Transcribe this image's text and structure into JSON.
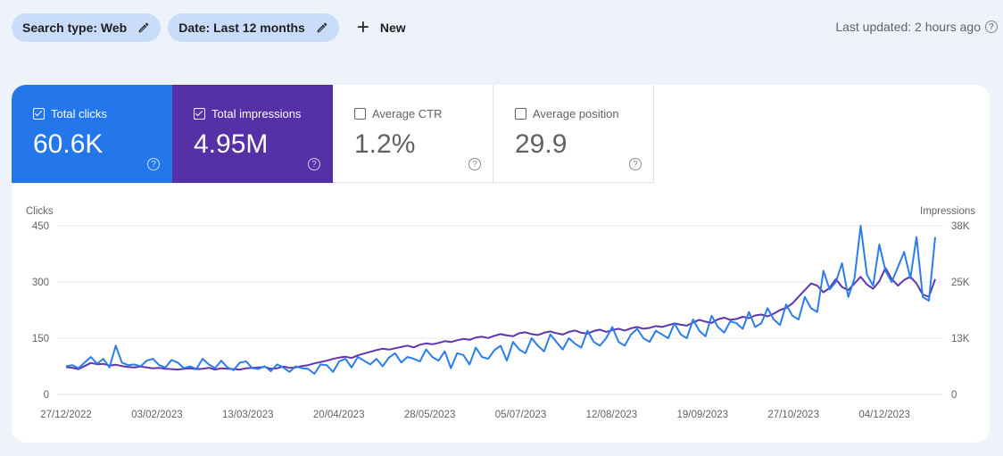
{
  "filters": {
    "search_type": "Search type: Web",
    "date": "Date: Last 12 months",
    "new_label": "New"
  },
  "status": {
    "last_updated": "Last updated: 2 hours ago"
  },
  "metrics": [
    {
      "label": "Total clicks",
      "value": "60.6K",
      "checked": true,
      "color": "#2377eb"
    },
    {
      "label": "Total impressions",
      "value": "4.95M",
      "checked": true,
      "color": "#5630a6"
    },
    {
      "label": "Average CTR",
      "value": "1.2%",
      "checked": false
    },
    {
      "label": "Average position",
      "value": "29.9",
      "checked": false
    }
  ],
  "chart_data": {
    "type": "line",
    "title": "",
    "ylabel": "Clicks",
    "y2label": "Impressions",
    "ylim": [
      0,
      450
    ],
    "y2lim": [
      0,
      38000
    ],
    "yticks": [
      "0",
      "150",
      "300",
      "450"
    ],
    "y2ticks": [
      "0",
      "13K",
      "25K",
      "38K"
    ],
    "xticks": [
      "27/12/2022",
      "03/02/2023",
      "13/03/2023",
      "20/04/2023",
      "28/05/2023",
      "05/07/2023",
      "12/08/2023",
      "19/09/2023",
      "27/10/2023",
      "04/12/2023"
    ],
    "x_start": "27/12/2022",
    "x_end": "26/12/2023",
    "grid": true,
    "series": [
      {
        "name": "Clicks",
        "axis": "left",
        "color": "#2b7de9",
        "values": [
          75,
          78,
          70,
          85,
          100,
          82,
          95,
          72,
          130,
          85,
          78,
          80,
          75,
          90,
          95,
          78,
          72,
          92,
          85,
          70,
          75,
          68,
          95,
          80,
          70,
          90,
          72,
          65,
          85,
          88,
          70,
          68,
          75,
          62,
          80,
          72,
          60,
          75,
          70,
          68,
          55,
          80,
          78,
          60,
          88,
          95,
          72,
          100,
          90,
          80,
          95,
          75,
          98,
          110,
          85,
          100,
          95,
          88,
          120,
          100,
          90,
          115,
          70,
          110,
          105,
          80,
          125,
          100,
          95,
          118,
          130,
          90,
          140,
          120,
          110,
          150,
          130,
          115,
          160,
          140,
          120,
          150,
          135,
          125,
          170,
          140,
          130,
          150,
          180,
          140,
          130,
          160,
          175,
          150,
          140,
          170,
          160,
          150,
          190,
          160,
          150,
          200,
          170,
          155,
          210,
          180,
          165,
          195,
          190,
          175,
          220,
          180,
          190,
          230,
          200,
          185,
          240,
          210,
          200,
          260,
          230,
          220,
          330,
          280,
          300,
          350,
          260,
          310,
          450,
          320,
          290,
          400,
          330,
          300,
          340,
          380,
          310,
          420,
          260,
          250,
          420
        ]
      },
      {
        "name": "Impressions",
        "axis": "right",
        "color": "#5e35b1",
        "values": [
          6200,
          6000,
          5700,
          6400,
          7100,
          6800,
          6900,
          6500,
          6700,
          6400,
          6200,
          6100,
          6300,
          6100,
          5900,
          6000,
          5800,
          5700,
          5600,
          5800,
          5900,
          5700,
          5800,
          6000,
          5600,
          5900,
          5800,
          5700,
          5600,
          5900,
          6000,
          6100,
          6200,
          5800,
          5900,
          6300,
          6000,
          6100,
          6400,
          6600,
          7000,
          7300,
          7600,
          8000,
          8300,
          8500,
          8200,
          8800,
          9200,
          9600,
          10000,
          10300,
          10100,
          10400,
          10700,
          11000,
          10600,
          11200,
          11500,
          11300,
          11600,
          12000,
          11800,
          12200,
          12500,
          12300,
          12800,
          13000,
          12700,
          13200,
          13600,
          13300,
          13100,
          13800,
          14000,
          13600,
          13400,
          13900,
          14200,
          13800,
          13500,
          14100,
          14400,
          13900,
          13700,
          14300,
          14600,
          14100,
          14500,
          14800,
          14400,
          14900,
          15200,
          14800,
          15000,
          15400,
          15200,
          15600,
          16000,
          15700,
          15500,
          16200,
          16800,
          16400,
          16100,
          16900,
          17300,
          16800,
          17000,
          17500,
          17200,
          17800,
          18000,
          17600,
          18200,
          19000,
          19500,
          20500,
          22000,
          23500,
          25000,
          24500,
          23000,
          24000,
          26000,
          24200,
          23500,
          25000,
          26500,
          24800,
          23800,
          25500,
          28500,
          26000,
          24500,
          25800,
          26500,
          25000,
          22500,
          22000,
          26000
        ]
      }
    ]
  }
}
